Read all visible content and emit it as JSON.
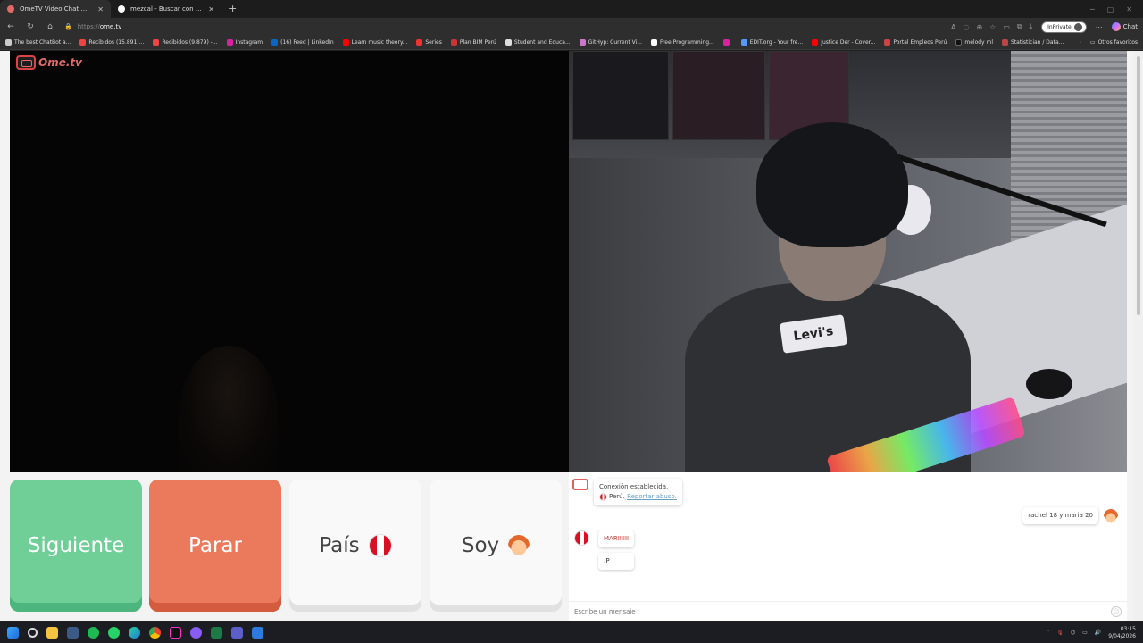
{
  "browser": {
    "tabs": [
      {
        "title": "OmeTV Video Chat — Omegle...",
        "close": "✕",
        "active": true
      },
      {
        "title": "mezcal - Buscar con Google",
        "close": "✕",
        "active": false
      }
    ],
    "new_tab": "+",
    "url_protocol": "https://",
    "url_host": "ome.tv",
    "inprivate_label": "InPrivate",
    "copilot_label": "Chat",
    "bookmarks": [
      "The best ChatBot a...",
      "Recibidos (15.891)...",
      "Recibidos (9.879) -...",
      "Instagram",
      "(16) Feed | LinkedIn",
      "Learn music theory...",
      "Series",
      "Plan BIM Perú",
      "Student and Educa...",
      "GitHyp: Current Vi...",
      "Free Programming...",
      "",
      "EDIT.org - Your fre...",
      "Justice Der - Cover...",
      "Portal Empleos Perú",
      "melody ml",
      "Statistician / Data..."
    ],
    "bookmarks_more": "›",
    "other_favorites": "Otros favoritos"
  },
  "site": {
    "logo_text": "Ome.tv",
    "remote_shirt_text": "Levi's",
    "buttons": {
      "next": "Siguiente",
      "stop": "Parar",
      "country": "País",
      "gender": "Soy"
    },
    "chat": {
      "system_line1": "Conexión establecida.",
      "system_country": "Perú.",
      "report_link": "Reportar abuso.",
      "my_message": "rachel 18 y maria 20",
      "their_messages": [
        "MARIIIIII",
        ":P"
      ],
      "input_placeholder": "Escribe un mensaje",
      "emoji_icon": "☺"
    }
  },
  "taskbar": {
    "time": "03:15",
    "date": "9/04/2026"
  },
  "colors": {
    "next": "#6fcf97",
    "stop": "#eb7a5c",
    "brand": "#e06a6a"
  }
}
